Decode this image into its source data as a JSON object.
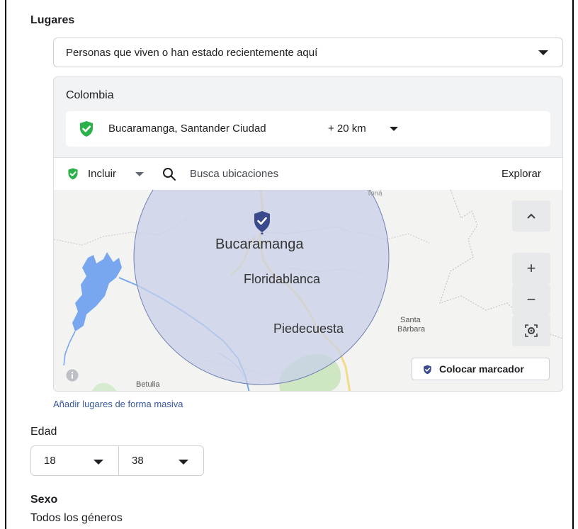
{
  "locations": {
    "label": "Lugares",
    "audience_select": "Personas que viven o han estado recientemente aquí",
    "country": "Colombia",
    "selected_location": "Bucaramanga, Santander Ciudad",
    "radius": "+ 20 km",
    "include_label": "Incluir",
    "search_placeholder": "Busca ubicaciones",
    "explore_label": "Explorar",
    "bulk_add_link": "Añadir lugares de forma masiva"
  },
  "map": {
    "place_names": {
      "bucaramanga": "Bucaramanga",
      "floridablanca": "Floridablanca",
      "piedecuesta": "Piedecuesta",
      "santa_barbara_1": "Santa",
      "santa_barbara_2": "Bárbara",
      "betulia": "Betulia",
      "tona": "Toná"
    },
    "zoom_in": "+",
    "zoom_out": "−",
    "collapse": "^",
    "place_marker_label": "Colocar marcador"
  },
  "age": {
    "label": "Edad",
    "min": "18",
    "max": "38"
  },
  "gender": {
    "label": "Sexo",
    "value": "Todos los géneros"
  },
  "colors": {
    "include_green": "#2bb14a",
    "radius_fill": "#c8d0e8",
    "marker_blue": "#3b4a8c",
    "link_blue": "#385898",
    "water": "#78a7f0"
  }
}
